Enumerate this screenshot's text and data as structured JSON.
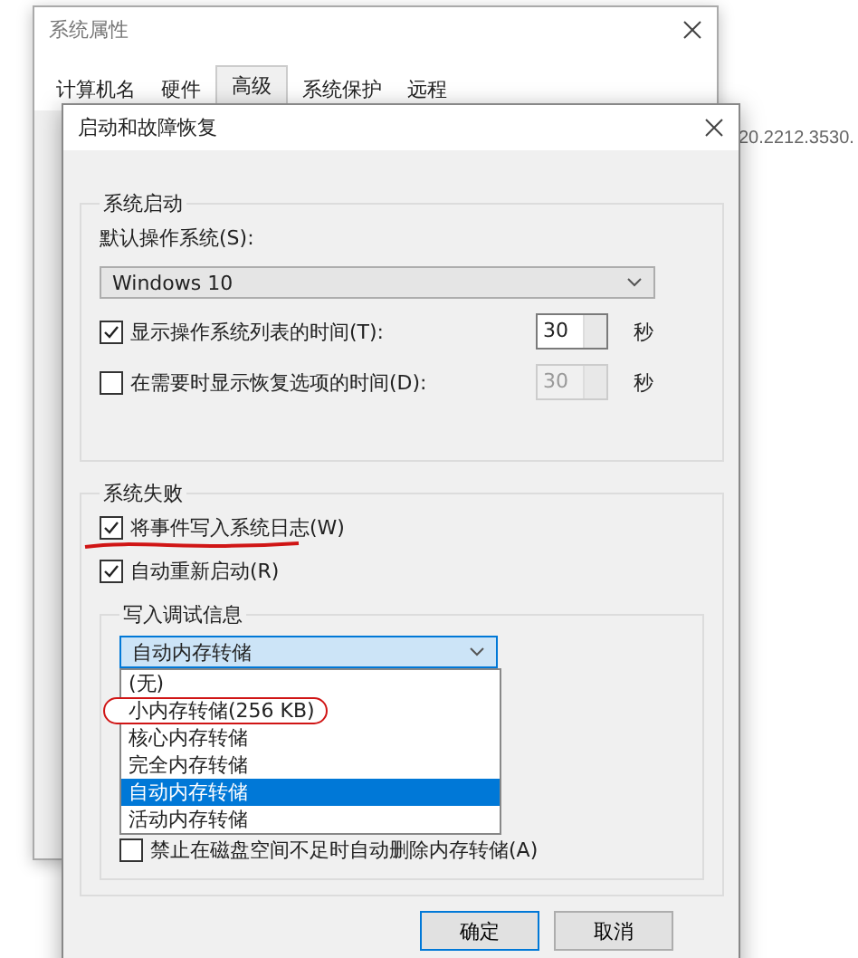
{
  "background_text": "20.2212.3530.",
  "back_window": {
    "title": "系统属性",
    "tabs": [
      {
        "label": "计算机名",
        "selected": false
      },
      {
        "label": "硬件",
        "selected": false
      },
      {
        "label": "高级",
        "selected": true
      },
      {
        "label": "系统保护",
        "selected": false
      },
      {
        "label": "远程",
        "selected": false
      }
    ]
  },
  "dialog": {
    "title": "启动和故障恢复",
    "startup": {
      "title": "系统启动",
      "default_os_label": "默认操作系统(S):",
      "default_os": "Windows 10",
      "rows": [
        {
          "label": "显示操作系统列表的时间(T):",
          "checked": true,
          "value": "30",
          "unit": "秒"
        },
        {
          "label": "在需要时显示恢复选项的时间(D):",
          "checked": false,
          "value": "30",
          "unit": "秒"
        }
      ]
    },
    "failure": {
      "title": "系统失败",
      "options": [
        {
          "label": "将事件写入系统日志(W)",
          "checked": true
        },
        {
          "label": "自动重新启动(R)",
          "checked": true
        }
      ],
      "debug": {
        "title": "写入调试信息",
        "value": "自动内存转储",
        "expanded": true,
        "options": [
          {
            "label": "(无)",
            "selected": false,
            "circled": false
          },
          {
            "label": "小内存转储(256 KB)",
            "selected": false,
            "circled": true
          },
          {
            "label": "核心内存转储",
            "selected": false,
            "circled": false
          },
          {
            "label": "完全内存转储",
            "selected": false,
            "circled": false
          },
          {
            "label": "自动内存转储",
            "selected": true,
            "circled": false
          },
          {
            "label": "活动内存转储",
            "selected": false,
            "circled": false
          }
        ],
        "overwrite": {
          "label": "禁止在磁盘空间不足时自动删除内存转储(A)",
          "checked": false
        }
      }
    },
    "buttons": [
      "确定",
      "取消"
    ]
  }
}
